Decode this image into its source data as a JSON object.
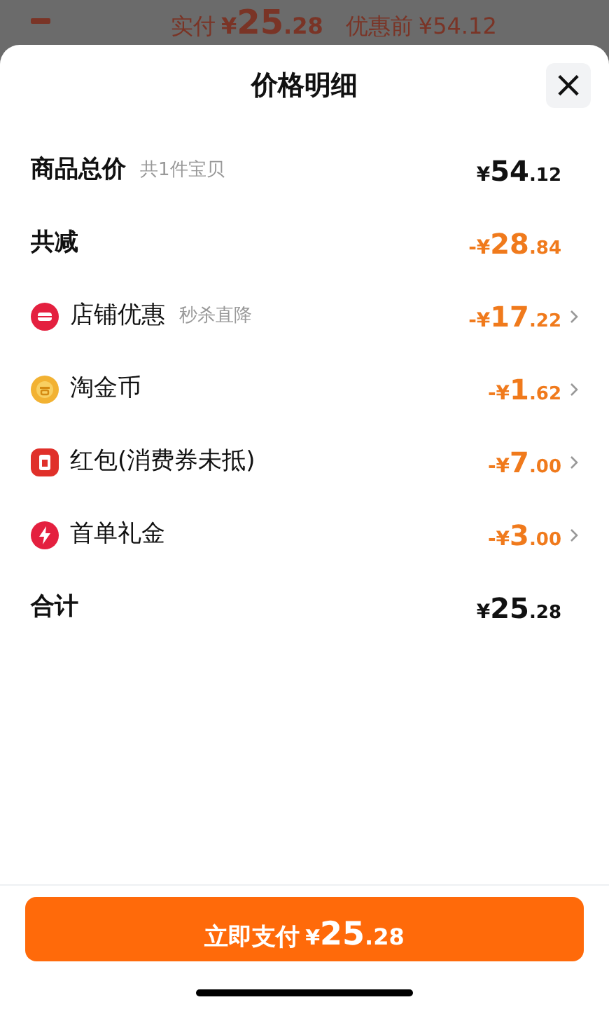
{
  "background": {
    "paid_label": "实付",
    "paid": {
      "prefix": "¥",
      "integer": "25",
      "decimal": ".28"
    },
    "original_label": "优惠前",
    "original": "¥54.12"
  },
  "sheet": {
    "title": "价格明细",
    "close": "×"
  },
  "rows": [
    {
      "kind": "total",
      "label": "商品总价",
      "note": "共1件宝贝",
      "amount": {
        "prefix": "¥",
        "integer": "54",
        "decimal": ".12"
      }
    },
    {
      "kind": "reduction",
      "label": "共减",
      "amount": {
        "prefix": "-¥",
        "integer": "28",
        "decimal": ".84"
      }
    },
    {
      "kind": "discount",
      "label": "店铺优惠",
      "note": "秒杀直降",
      "amount": {
        "prefix": "-¥",
        "integer": "17",
        "decimal": ".22"
      }
    },
    {
      "kind": "discount",
      "label": "淘金币",
      "amount": {
        "prefix": "-¥",
        "integer": "1",
        "decimal": ".62"
      }
    },
    {
      "kind": "discount",
      "label": "红包(消费券未抵)",
      "amount": {
        "prefix": "-¥",
        "integer": "7",
        "decimal": ".00"
      }
    },
    {
      "kind": "discount",
      "label": "首单礼金",
      "amount": {
        "prefix": "-¥",
        "integer": "3",
        "decimal": ".00"
      }
    },
    {
      "kind": "sum",
      "label": "合计",
      "amount": {
        "prefix": "¥",
        "integer": "25",
        "decimal": ".28"
      }
    }
  ],
  "pay_button": {
    "label": "立即支付",
    "amount": {
      "prefix": "¥",
      "integer": "25",
      "decimal": ".28"
    }
  }
}
